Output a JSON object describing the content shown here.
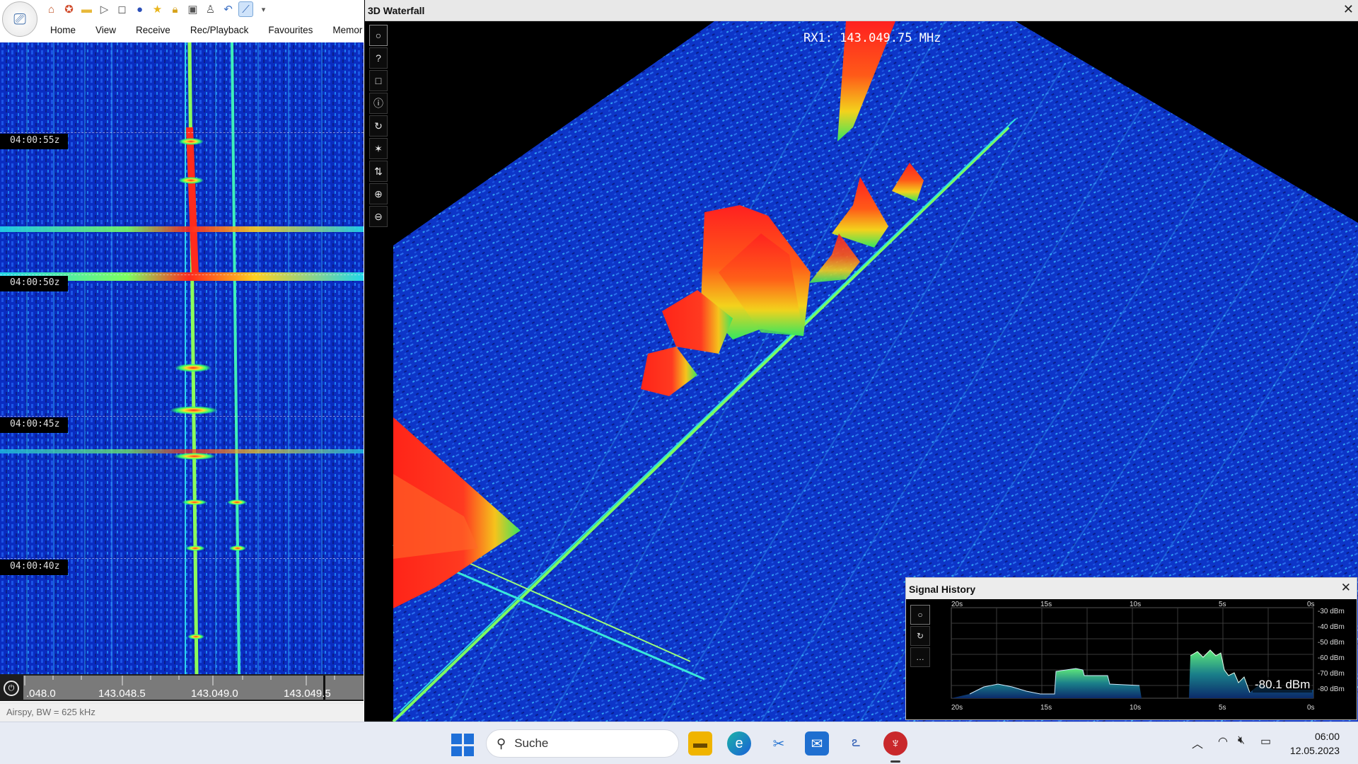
{
  "left_window": {
    "tabs": [
      "Home",
      "View",
      "Receive",
      "Rec/Playback",
      "Favourites",
      "Memor"
    ],
    "timestamps": [
      "04:00:55z",
      "04:00:50z",
      "04:00:45z",
      "04:00:40z"
    ],
    "freq_labels": [
      ".048.0",
      "143.048.5",
      "143.049.0",
      "143.049.5"
    ],
    "status": "Airspy, BW = 625 kHz"
  },
  "waterfall3d": {
    "title": "3D Waterfall",
    "close_icon": "close-icon",
    "rx_label": "RX1: 143.049.75 MHz",
    "toolbar_icons": [
      "circle-icon",
      "help-icon",
      "square-icon",
      "info-icon",
      "refresh-icon",
      "star-icon",
      "updown-arrows-icon",
      "zoom-in-icon",
      "zoom-out-icon"
    ],
    "toolbar_glyphs": [
      "○",
      "?",
      "□",
      "ⓘ",
      "↻",
      "✶",
      "⇅",
      "⊕",
      "⊖"
    ]
  },
  "signal_history": {
    "title": "Signal History",
    "top_axis": [
      "20s",
      "15s",
      "10s",
      "5s",
      "0s"
    ],
    "bottom_axis": [
      "20s",
      "15s",
      "10s",
      "5s",
      "0s"
    ],
    "db_labels": [
      "-30 dBm",
      "-40 dBm",
      "-50 dBm",
      "-60 dBm",
      "-70 dBm",
      "-80 dBm"
    ],
    "current": "-80.1 dBm",
    "button_glyphs": [
      "○",
      "↻",
      "…"
    ]
  },
  "taskbar": {
    "search_placeholder": "Suche",
    "time": "06:00",
    "date": "12.05.2023"
  },
  "colors": {
    "waterfall_blue": "#0a30c8",
    "signal_red": "#ff2a1c",
    "signal_green": "#30ff60",
    "accent": "#1e6fd8"
  }
}
